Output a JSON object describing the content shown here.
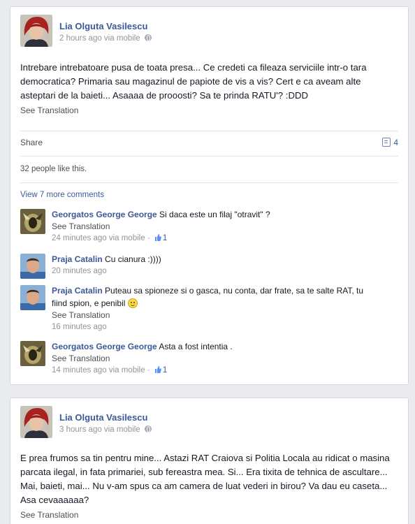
{
  "posts": [
    {
      "author": "Lia Olguta Vasilescu",
      "time": "2 hours ago via mobile",
      "text": "Intrebare intrebatoare pusa de toata presa... Ce credeti ca fileaza serviciile intr-o tara democratica? Primaria sau magazinul de papiote de vis a vis? Cert e ca aveam alte asteptari de la baieti... Asaaaa de prooosti? Sa te prinda RATU'? :DDD",
      "see_translation": "See Translation",
      "share": "Share",
      "comment_count": "4",
      "likes": "32 people like this.",
      "view_more": "View 7 more comments",
      "comments": [
        {
          "author": "Georgatos George George",
          "text": "Si daca este un filaj \"otravit\" ?",
          "see_translation": "See Translation",
          "time": "24 minutes ago via mobile",
          "likes": "1"
        },
        {
          "author": "Praja Catalin",
          "text": "Cu cianura :))))",
          "time": "20 minutes ago"
        },
        {
          "author": "Praja Catalin",
          "text_line1": "Puteau sa spioneze si o gasca, nu conta, dar frate, sa te salte RAT, tu",
          "text_line2": "fiind spion, e penibil",
          "emoticon": "smile-icon",
          "see_translation": "See Translation",
          "time": "16 minutes ago"
        },
        {
          "author": "Georgatos George George",
          "text": "Asta a fost intentia .",
          "see_translation": "See Translation",
          "time": "14 minutes ago via mobile",
          "likes": "1"
        }
      ]
    },
    {
      "author": "Lia Olguta Vasilescu",
      "time": "3 hours ago via mobile",
      "text": "E prea frumos sa tin pentru mine... Astazi RAT Craiova si Politia Locala au ridicat o masina parcata ilegal, in fata primariei, sub fereastra mea. Si... Era tixita de tehnica de ascultare... Mai, baieti, mai... Nu v-am spus ca am camera de luat vederi in birou? Va dau eu caseta... Asa cevaaaaaa?",
      "see_translation": "See Translation"
    }
  ],
  "colors": {
    "link": "#3b5998",
    "meta": "#90949c",
    "background": "#e9ebee"
  },
  "icons": {
    "privacy": "globe-icon",
    "comments": "comment-icon",
    "like": "thumbs-up-icon"
  }
}
